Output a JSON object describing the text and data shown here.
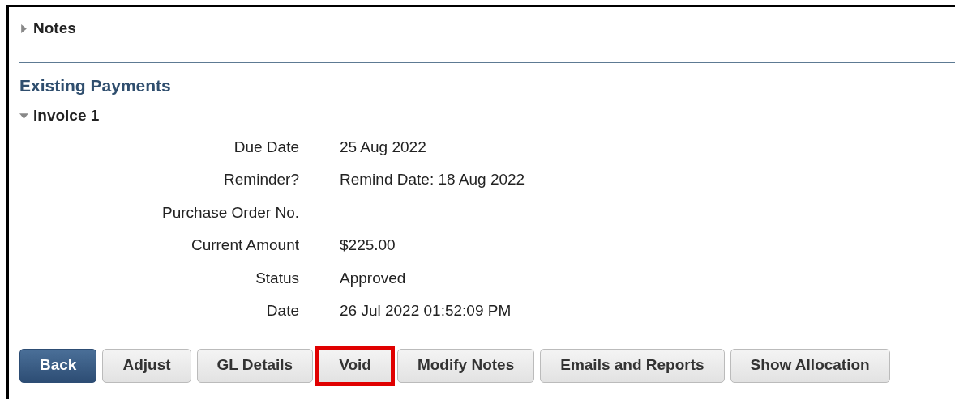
{
  "sections": [
    {
      "label": "Notes",
      "expanded": false
    }
  ],
  "heading": "Existing Payments",
  "invoice": {
    "label": "Invoice 1",
    "expanded": true,
    "fields": [
      {
        "label": "Due Date",
        "value": "25 Aug 2022"
      },
      {
        "label": "Reminder?",
        "value": "Remind Date: 18 Aug 2022"
      },
      {
        "label": "Purchase Order No."
      },
      {
        "label": "Current Amount",
        "value": "$225.00"
      },
      {
        "label": "Status",
        "value": "Approved"
      },
      {
        "label": "Date",
        "value": "26 Jul 2022 01:52:09 PM"
      }
    ]
  },
  "buttons": [
    {
      "label": "Back",
      "kind": "primary",
      "highlighted": false
    },
    {
      "label": "Adjust",
      "kind": "default",
      "highlighted": false
    },
    {
      "label": "GL Details",
      "kind": "default",
      "highlighted": false
    },
    {
      "label": "Void",
      "kind": "default",
      "highlighted": true
    },
    {
      "label": "Modify Notes",
      "kind": "default",
      "highlighted": false
    },
    {
      "label": "Emails and Reports",
      "kind": "default",
      "highlighted": false
    },
    {
      "label": "Show Allocation",
      "kind": "default",
      "highlighted": false
    }
  ]
}
